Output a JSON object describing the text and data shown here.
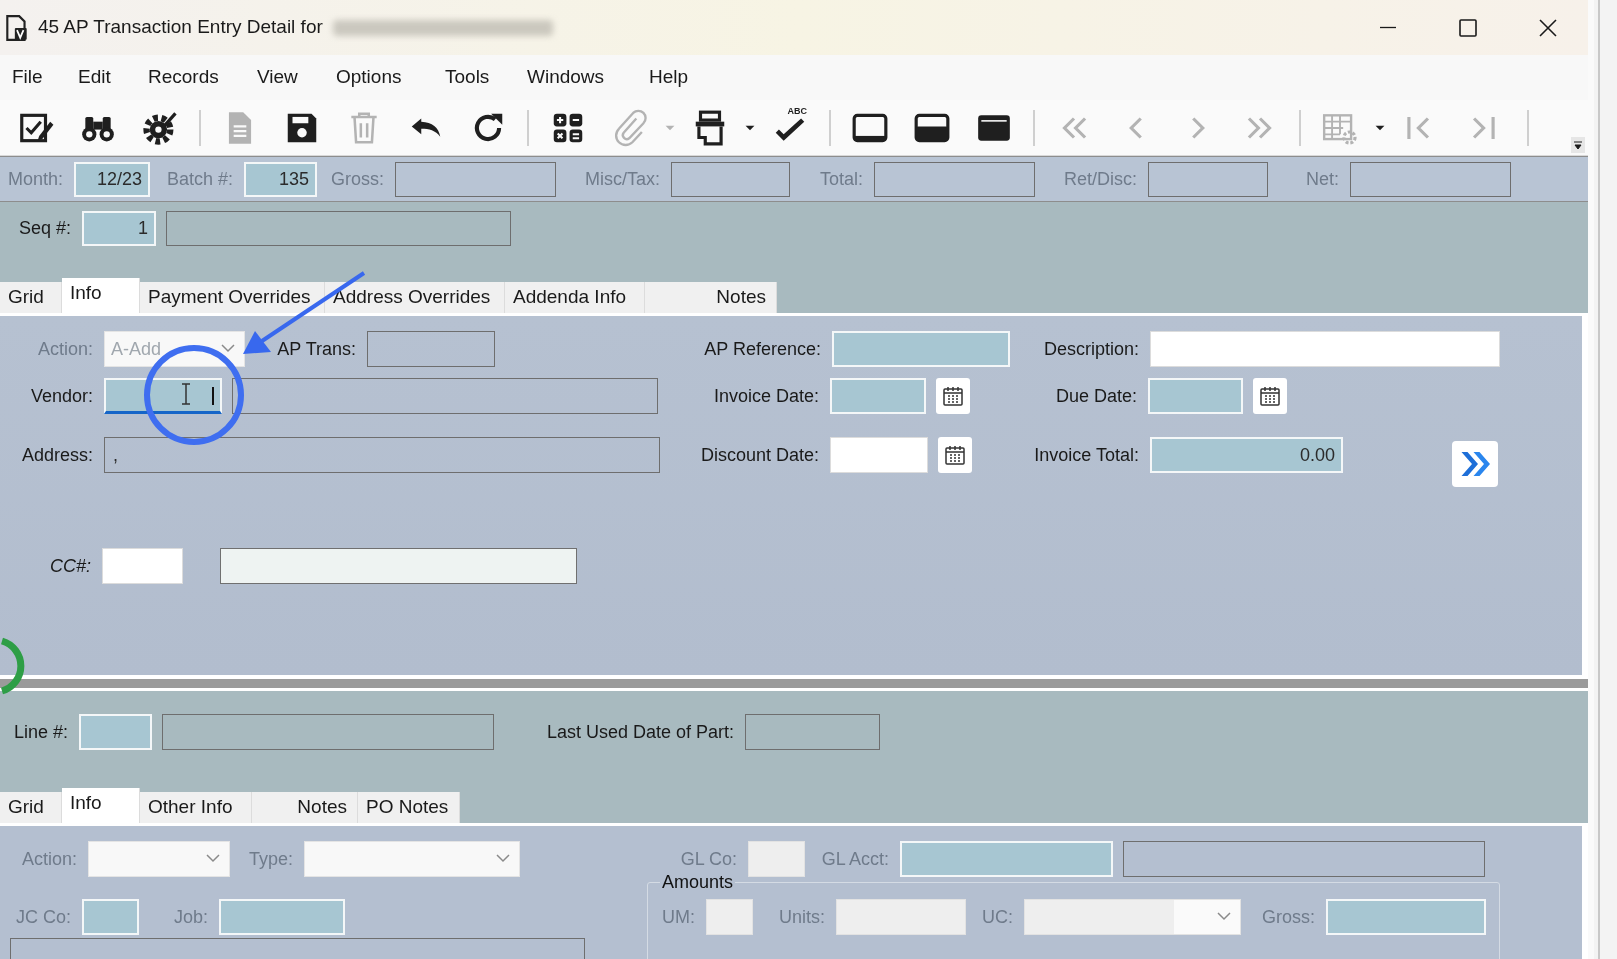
{
  "window": {
    "title": "45 AP Transaction Entry Detail for"
  },
  "menu": [
    "File",
    "Edit",
    "Records",
    "View",
    "Options",
    "Tools",
    "Windows",
    "Help"
  ],
  "toolbar": [
    [
      {
        "kind": "edit",
        "disabled": false
      },
      {
        "kind": "find",
        "disabled": false
      },
      {
        "kind": "gear",
        "disabled": false
      }
    ],
    [
      {
        "kind": "new",
        "disabled": true
      },
      {
        "kind": "save",
        "disabled": false
      },
      {
        "kind": "delete",
        "disabled": true
      },
      {
        "kind": "undo",
        "disabled": false
      },
      {
        "kind": "redo",
        "disabled": false
      }
    ],
    [
      {
        "kind": "calc",
        "disabled": false
      },
      {
        "kind": "attach",
        "disabled": true
      },
      {
        "kind": "dropdown",
        "disabled": true
      },
      {
        "kind": "print",
        "disabled": false
      },
      {
        "kind": "dropdown",
        "disabled": false
      },
      {
        "kind": "spell",
        "label": "ABC",
        "disabled": false
      }
    ],
    [
      {
        "kind": "layout-bottom",
        "disabled": false
      },
      {
        "kind": "layout-half",
        "disabled": false
      },
      {
        "kind": "layout-full",
        "disabled": false
      }
    ],
    [
      {
        "kind": "first",
        "disabled": true
      },
      {
        "kind": "prev",
        "disabled": true
      },
      {
        "kind": "next",
        "disabled": true
      },
      {
        "kind": "last",
        "disabled": true
      }
    ],
    [
      {
        "kind": "grid-settings",
        "disabled": true
      },
      {
        "kind": "dropdown",
        "disabled": false
      },
      {
        "kind": "first-bar",
        "disabled": true
      },
      {
        "kind": "last-bar",
        "disabled": true
      }
    ]
  ],
  "header": [
    {
      "label": "Month:",
      "disabled": true,
      "boxes": [
        {
          "kind": "key",
          "value": "12/23"
        }
      ]
    },
    {
      "label": "Batch #:",
      "disabled": true,
      "boxes": [
        {
          "kind": "key",
          "value": "135"
        }
      ]
    },
    {
      "label": "Gross:",
      "disabled": true,
      "boxes": [
        {
          "kind": "readonly"
        }
      ]
    },
    {
      "label": "Misc/Tax:",
      "disabled": true,
      "boxes": [
        {
          "kind": "readonly"
        }
      ]
    },
    {
      "label": "Total:",
      "disabled": true,
      "boxes": [
        {
          "kind": "readonly"
        }
      ]
    },
    {
      "label": "Ret/Disc:",
      "disabled": true,
      "boxes": [
        {
          "kind": "readonly"
        }
      ]
    },
    {
      "label": "Net:",
      "disabled": true,
      "boxes": [
        {
          "kind": "readonly"
        }
      ]
    }
  ],
  "seq": [
    {
      "label": "Seq #:",
      "disabled": false,
      "boxes": [
        {
          "kind": "key",
          "value": "1"
        },
        {
          "kind": "readonly"
        }
      ]
    }
  ],
  "tabs": [
    {
      "label": "Grid",
      "selected": false
    },
    {
      "label": "Info",
      "selected": true
    },
    {
      "label": "Payment Overrides",
      "selected": false
    },
    {
      "label": "Address Overrides",
      "selected": false
    },
    {
      "label": "Addenda Info",
      "selected": false
    },
    {
      "label": "Notes",
      "selected": false
    }
  ],
  "info": [
    [
      {
        "label": "Action:",
        "disabled": true,
        "boxes": [
          {
            "kind": "combo",
            "value": "A-Add"
          }
        ]
      },
      {
        "label": "AP Trans:",
        "disabled": false,
        "boxes": [
          {
            "kind": "readonly"
          }
        ]
      },
      {
        "label": "AP Reference:",
        "disabled": false,
        "boxes": [
          {
            "kind": "key"
          }
        ]
      },
      {
        "label": "Description:",
        "disabled": false,
        "boxes": [
          {
            "kind": "input"
          }
        ]
      }
    ],
    [
      {
        "label": "Vendor:",
        "disabled": false,
        "boxes": [
          {
            "kind": "focused-key"
          },
          {
            "kind": "readonly"
          }
        ]
      },
      {
        "label": "Invoice Date:",
        "disabled": false,
        "boxes": [
          {
            "kind": "key"
          },
          {
            "kind": "calendar"
          }
        ]
      },
      {
        "label": "Due Date:",
        "disabled": false,
        "boxes": [
          {
            "kind": "key"
          },
          {
            "kind": "calendar"
          }
        ]
      }
    ],
    [
      {
        "label": "Address:",
        "disabled": false,
        "boxes": [
          {
            "kind": "readonly",
            "value": ","
          }
        ]
      },
      {
        "label": "Discount Date:",
        "disabled": false,
        "boxes": [
          {
            "kind": "input"
          },
          {
            "kind": "calendar"
          }
        ]
      },
      {
        "label": "Invoice Total:",
        "disabled": false,
        "boxes": [
          {
            "kind": "key",
            "value": "0.00"
          }
        ]
      }
    ],
    [
      {
        "label": "CC#:",
        "disabled": false,
        "boxes": [
          {
            "kind": "input"
          }
        ]
      },
      {
        "boxes": [
          {
            "kind": "light"
          }
        ]
      }
    ]
  ],
  "line": [
    {
      "label": "Line #:",
      "disabled": false,
      "boxes": [
        {
          "kind": "key"
        },
        {
          "kind": "readonly"
        }
      ]
    },
    {
      "label": "Last Used Date of Part:",
      "disabled": false,
      "boxes": [
        {
          "kind": "readonly"
        }
      ]
    }
  ],
  "line_tabs": [
    {
      "label": "Grid",
      "selected": false
    },
    {
      "label": "Info",
      "selected": true
    },
    {
      "label": "Other Info",
      "selected": false
    },
    {
      "label": "Notes",
      "selected": false
    },
    {
      "label": "PO Notes",
      "selected": false
    }
  ],
  "lower": {
    "row_1": [
      {
        "label": "Action:",
        "disabled": true,
        "boxes": [
          {
            "kind": "combo"
          }
        ]
      },
      {
        "label": "Type:",
        "disabled": true,
        "boxes": [
          {
            "kind": "combo"
          }
        ]
      },
      {
        "label": "GL Co:",
        "disabled": true,
        "boxes": [
          {
            "kind": "dim"
          }
        ]
      },
      {
        "label": "GL Acct:",
        "disabled": true,
        "boxes": [
          {
            "kind": "key"
          },
          {
            "kind": "readonly"
          }
        ]
      }
    ],
    "row_2": [
      {
        "label": "JC Co:",
        "disabled": true,
        "boxes": [
          {
            "kind": "key"
          }
        ]
      },
      {
        "label": "Job:",
        "disabled": true,
        "boxes": [
          {
            "kind": "key"
          }
        ]
      }
    ],
    "row_3": [
      {
        "boxes": [
          {
            "kind": "readonly"
          }
        ]
      }
    ],
    "amounts": {
      "title": "Amounts",
      "fields": [
        {
          "label": "UM:",
          "disabled": true,
          "boxes": [
            {
              "kind": "dim"
            }
          ]
        },
        {
          "label": "Units:",
          "disabled": true,
          "boxes": [
            {
              "kind": "dim"
            }
          ]
        },
        {
          "label": "UC:",
          "disabled": true,
          "boxes": [
            {
              "kind": "dim-combo"
            }
          ]
        },
        {
          "label": "Gross:",
          "disabled": true,
          "boxes": [
            {
              "kind": "key"
            }
          ]
        }
      ]
    }
  }
}
